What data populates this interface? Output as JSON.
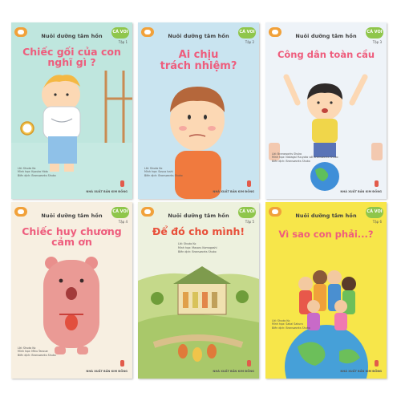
{
  "colors": {
    "series_green": "#8fc64b",
    "publisher_orange": "#f1a13a",
    "title_pink": "#ee5d7d",
    "title_red": "#e8503a"
  },
  "books": [
    {
      "series": "Nuôi dưỡng tâm hồn",
      "badge": "CÁ VOI",
      "volume": "Tập 1",
      "title_lines": [
        "Chiếc gối của con",
        "nghĩ gì ?"
      ],
      "credits": [
        "Lời: Shudo Ko",
        "Minh họa: Kyouko Hida",
        "Biên dịch: Bransworks Shuko"
      ],
      "publisher": "NHÀ XUẤT BẢN KIM ĐỒNG",
      "illustration_icon": "boy-hugging-pillow-icon"
    },
    {
      "series": "Nuôi dưỡng tâm hồn",
      "badge": "CÁ VOI",
      "volume": "Tập 2",
      "title_lines": [
        "Ai chịu",
        "trách nhiệm?"
      ],
      "credits": [
        "Lời: Shudo Ko",
        "Minh họa: Sosuo Isshi",
        "Biên dịch: Bransworks Shuko"
      ],
      "publisher": "NHÀ XUẤT BẢN KIM ĐỒNG",
      "illustration_icon": "thinking-boy-icon"
    },
    {
      "series": "Nuôi dưỡng tâm hồn",
      "badge": "CÁ VOI",
      "volume": "Tập 3",
      "title_lines": [
        "Công dân toàn cầu"
      ],
      "credits": [
        "Lời: Bransworks Shuko",
        "Minh họa: Nakagai Yuuyoko với Bransworks Shuko",
        "Biên dịch: Bransworks Shuko"
      ],
      "publisher": "NHÀ XUẤT BẢN KIM ĐỒNG",
      "illustration_icon": "boy-on-globe-icon"
    },
    {
      "series": "Nuôi dưỡng tâm hồn",
      "badge": "CÁ VOI",
      "volume": "Tập 4",
      "title_lines": [
        "Chiếc huy chương",
        "cảm ơn"
      ],
      "credits": [
        "Lời: Shudo Ko",
        "Minh họa: Miku Tanoue",
        "Biên dịch: Bransworks Shuko"
      ],
      "publisher": "NHÀ XUẤT BẢN KIM ĐỒNG",
      "illustration_icon": "pink-bear-icon"
    },
    {
      "series": "Nuôi dưỡng tâm hồn",
      "badge": "CÁ VOI",
      "volume": "Tập 5",
      "title_lines": [
        "Để đó cho mình!"
      ],
      "credits": [
        "Lời: Shudo Ko",
        "Minh họa: Masaru Kamagoshi",
        "Biên dịch: Bransworks Shuko"
      ],
      "publisher": "NHÀ XUẤT BẢN KIM ĐỒNG",
      "illustration_icon": "vegetable-village-icon"
    },
    {
      "series": "Nuôi dưỡng tâm hồn",
      "badge": "CÁ VOI",
      "volume": "Tập 6",
      "title_lines": [
        "Vì sao con phải...?"
      ],
      "credits": [
        "Lời: Shudo Ko",
        "Minh họa: Sakai Sakura",
        "Biên dịch: Bransworks Shuko"
      ],
      "publisher": "NHÀ XUẤT BẢN KIM ĐỒNG",
      "illustration_icon": "children-on-globe-icon"
    }
  ]
}
